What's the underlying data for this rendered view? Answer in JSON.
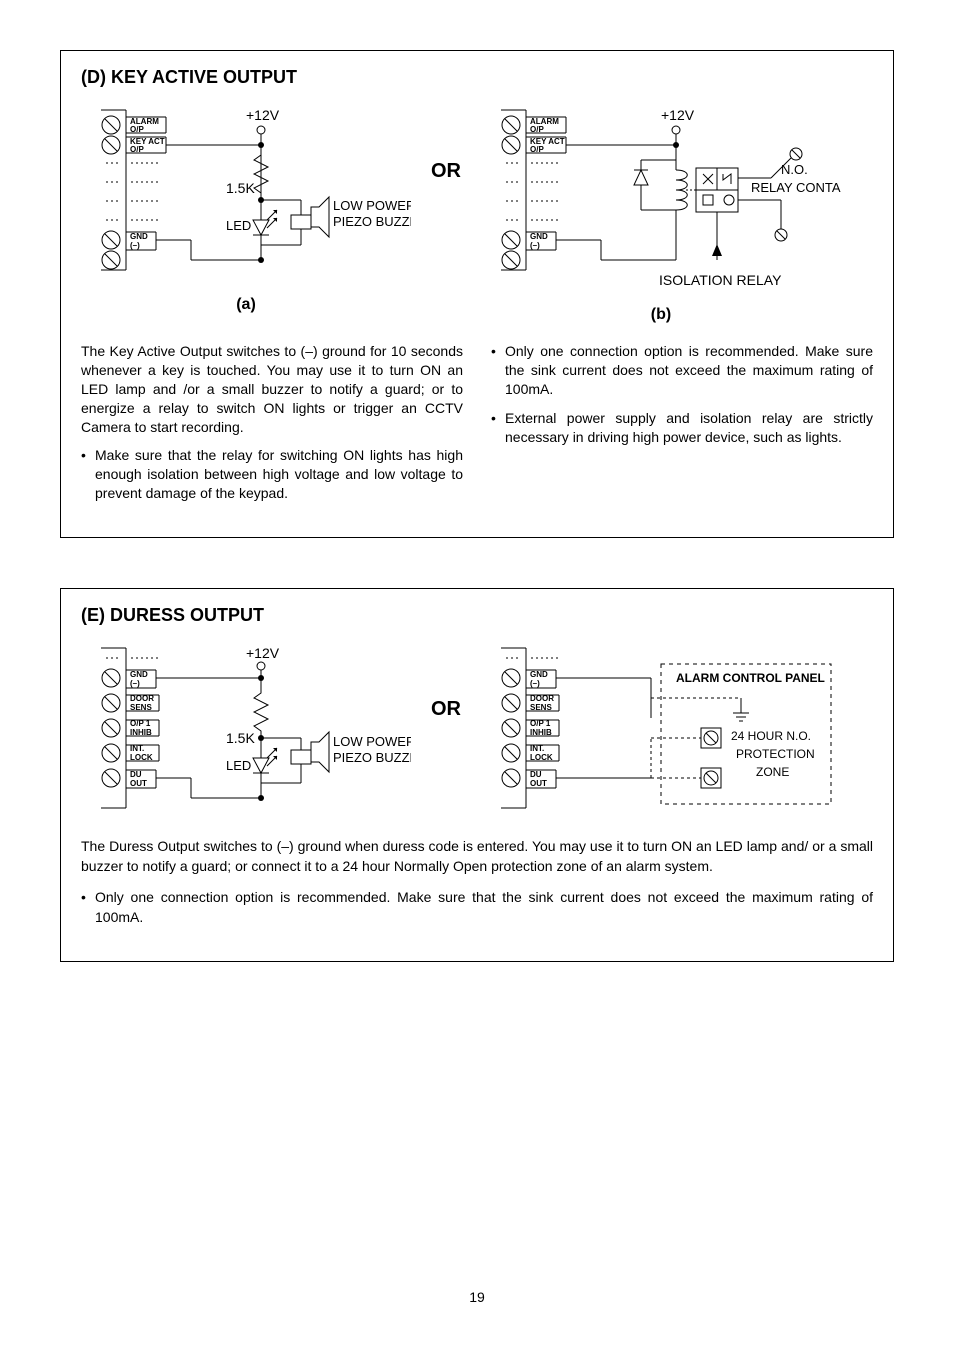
{
  "sectionD": {
    "title": "(D) KEY ACTIVE OUTPUT",
    "captions": {
      "a": "(a)",
      "b": "(b)"
    },
    "labels": {
      "alarm_op": "ALARM O/P",
      "key_act_op": "KEY ACT O/P",
      "gnd": "GND (–)",
      "plus12v": "+12V",
      "r_1_5k": "1.5K",
      "led": "LED",
      "low_power": "LOW POWER",
      "piezo": "PIEZO BUZZER",
      "no": "N.O.",
      "relay_contact": "RELAY CONTACT",
      "isolation_relay": "ISOLATION RELAY",
      "or": "OR"
    },
    "text": {
      "para1": "The Key Active Output switches to (–) ground for 10 seconds whenever a key is touched. You may use it to turn ON an LED lamp and /or a small buzzer to notify a guard; or to energize a relay to switch ON lights or trigger an CCTV Camera to start recording.",
      "bul1": "Make sure that the relay for switching ON lights has high enough isolation between high voltage and low voltage to prevent damage of the keypad.",
      "bul2": "Only one connection option is recommended. Make sure the sink current does not exceed the maximum rating of 100mA.",
      "bul3": "External power supply and isolation relay are strictly necessary in driving high power device, such as lights."
    }
  },
  "sectionE": {
    "title": "(E) DURESS OUTPUT",
    "labels": {
      "gnd": "GND (–)",
      "door_sens": "DOOR SENS",
      "op1_inhib": "O/P 1 INHIB",
      "int_lock": "INT. LOCK",
      "du_out": "DU OUT",
      "plus12v": "+12V",
      "r_1_5k": "1.5K",
      "led": "LED",
      "low_power": "LOW POWER",
      "piezo": "PIEZO BUZZER",
      "alarm_panel": "ALARM CONTROL PANEL",
      "zone_line1": "24 HOUR N.O.",
      "zone_line2": "PROTECTION",
      "zone_line3": "ZONE",
      "or": "OR"
    },
    "text": {
      "para1": "The Duress Output switches to (–) ground when duress code is entered. You may use it to turn ON an LED lamp and/ or a small buzzer to notify a guard; or connect it to a 24 hour Normally Open protection zone of an alarm system.",
      "bul1": "Only one connection option is recommended. Make sure that the sink current does not exceed the maximum rating of 100mA."
    }
  },
  "pageNumber": "19"
}
